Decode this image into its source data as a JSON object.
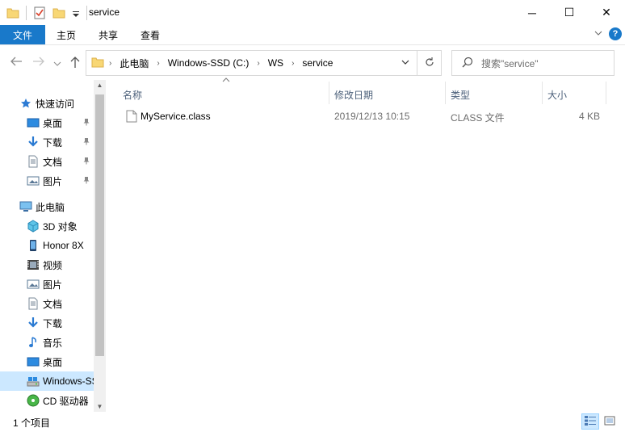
{
  "window": {
    "title": "service",
    "controls": {
      "minimize": "─",
      "maximize": "☐",
      "close": "✕"
    }
  },
  "ribbon": {
    "tabs": [
      "文件",
      "主页",
      "共享",
      "查看"
    ],
    "help_label": "?"
  },
  "address": {
    "crumbs": [
      "此电脑",
      "Windows-SSD (C:)",
      "WS",
      "service"
    ]
  },
  "search": {
    "placeholder": "搜索\"service\""
  },
  "navpane": {
    "items": [
      {
        "label": "快速访问",
        "icon": "star-icon",
        "pinned": false,
        "indent": 1
      },
      {
        "label": "桌面",
        "icon": "desktop-icon",
        "pinned": true,
        "indent": 2
      },
      {
        "label": "下载",
        "icon": "download-icon",
        "pinned": true,
        "indent": 2
      },
      {
        "label": "文档",
        "icon": "document-icon",
        "pinned": true,
        "indent": 2
      },
      {
        "label": "图片",
        "icon": "picture-icon",
        "pinned": true,
        "indent": 2
      },
      {
        "label": "此电脑",
        "icon": "computer-icon",
        "pinned": false,
        "indent": 1
      },
      {
        "label": "3D 对象",
        "icon": "3d-objects-icon",
        "pinned": false,
        "indent": 2
      },
      {
        "label": "Honor 8X",
        "icon": "phone-icon",
        "pinned": false,
        "indent": 2
      },
      {
        "label": "视频",
        "icon": "video-icon",
        "pinned": false,
        "indent": 2
      },
      {
        "label": "图片",
        "icon": "picture-icon",
        "pinned": false,
        "indent": 2
      },
      {
        "label": "文档",
        "icon": "document-icon",
        "pinned": false,
        "indent": 2
      },
      {
        "label": "下载",
        "icon": "download-icon",
        "pinned": false,
        "indent": 2
      },
      {
        "label": "音乐",
        "icon": "music-icon",
        "pinned": false,
        "indent": 2
      },
      {
        "label": "桌面",
        "icon": "desktop-icon",
        "pinned": false,
        "indent": 2
      },
      {
        "label": "Windows-SSD (C:)",
        "icon": "drive-icon",
        "pinned": false,
        "indent": 2,
        "selected": true
      },
      {
        "label": "CD 驱动器",
        "icon": "cd-drive-icon",
        "pinned": false,
        "indent": 2
      }
    ]
  },
  "columns": {
    "name": "名称",
    "modified": "修改日期",
    "type": "类型",
    "size": "大小"
  },
  "files": [
    {
      "name": "MyService.class",
      "modified": "2019/12/13 10:15",
      "type": "CLASS 文件",
      "size": "4 KB"
    }
  ],
  "status": {
    "item_count": "1 个项目"
  },
  "colors": {
    "accent": "#1979ca",
    "selection": "#cce8ff",
    "header_text": "#4c607a"
  }
}
